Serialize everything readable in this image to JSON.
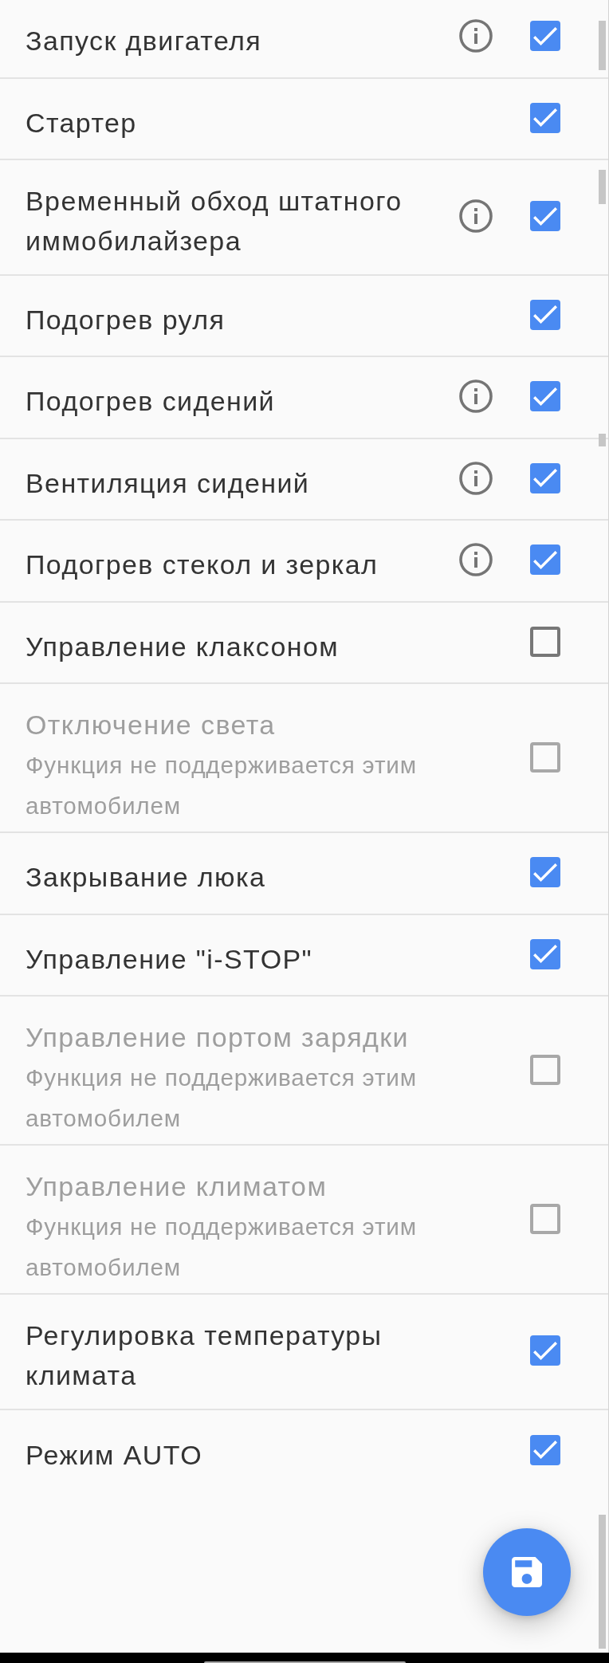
{
  "items": [
    {
      "title": "Запуск двигателя",
      "info": true,
      "checked": true,
      "disabled": false
    },
    {
      "title": "Стартер",
      "info": false,
      "checked": true,
      "disabled": false
    },
    {
      "title": "Временный обход штатного иммобилайзера",
      "info": true,
      "checked": true,
      "disabled": false
    },
    {
      "title": "Подогрев руля",
      "info": false,
      "checked": true,
      "disabled": false
    },
    {
      "title": "Подогрев сидений",
      "info": true,
      "checked": true,
      "disabled": false
    },
    {
      "title": "Вентиляция сидений",
      "info": true,
      "checked": true,
      "disabled": false
    },
    {
      "title": "Подогрев стекол и зеркал",
      "info": true,
      "checked": true,
      "disabled": false
    },
    {
      "title": "Управление клаксоном",
      "info": false,
      "checked": false,
      "disabled": false
    },
    {
      "title": "Отключение света",
      "subtitle": "Функция не поддерживается этим автомобилем",
      "info": false,
      "checked": false,
      "disabled": true
    },
    {
      "title": "Закрывание люка",
      "info": false,
      "checked": true,
      "disabled": false
    },
    {
      "title": "Управление \"i-STOP\"",
      "info": false,
      "checked": true,
      "disabled": false
    },
    {
      "title": "Управление портом зарядки",
      "subtitle": "Функция не поддерживается этим автомобилем",
      "info": false,
      "checked": false,
      "disabled": true
    },
    {
      "title": "Управление климатом",
      "subtitle": "Функция не поддерживается этим автомобилем",
      "info": false,
      "checked": false,
      "disabled": true
    },
    {
      "title": "Регулировка температуры климата",
      "info": false,
      "checked": true,
      "disabled": false
    },
    {
      "title": "Режим AUTO",
      "info": false,
      "checked": true,
      "disabled": false
    }
  ]
}
